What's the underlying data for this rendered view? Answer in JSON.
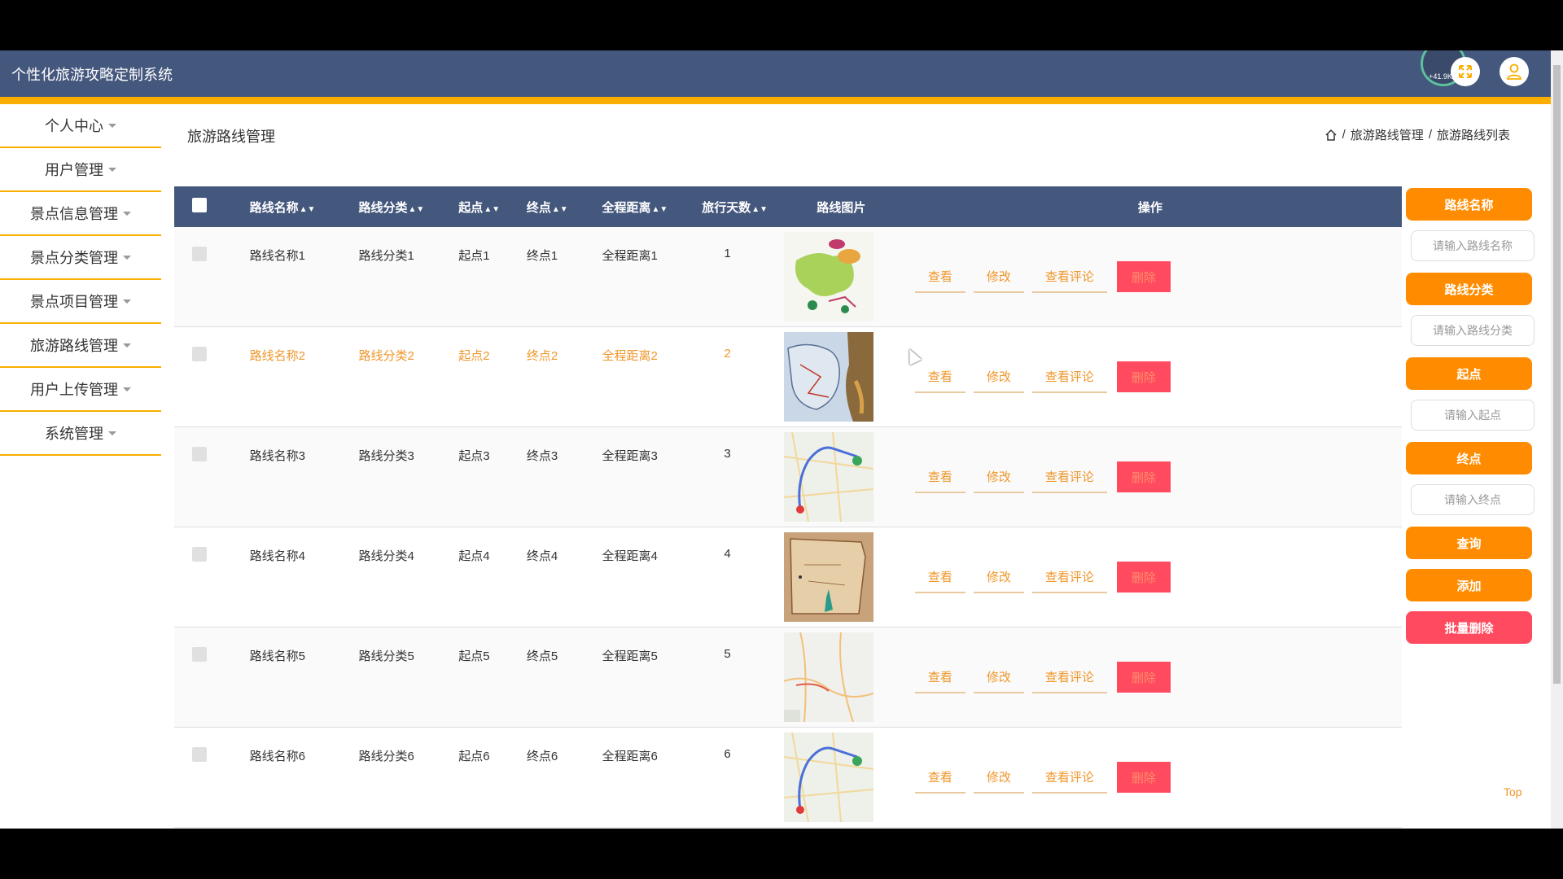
{
  "app": {
    "title": "个性化旅游攻略定制系统",
    "speed": "+41.9K/s"
  },
  "colors": {
    "header": "#44577d",
    "accent": "#f9ae00",
    "orange": "#ff8c00",
    "danger": "#ff4a5f",
    "link": "#f0962a"
  },
  "sidebar": {
    "items": [
      {
        "label": "个人中心"
      },
      {
        "label": "用户管理"
      },
      {
        "label": "景点信息管理"
      },
      {
        "label": "景点分类管理"
      },
      {
        "label": "景点项目管理"
      },
      {
        "label": "旅游路线管理"
      },
      {
        "label": "用户上传管理"
      },
      {
        "label": "系统管理"
      }
    ]
  },
  "page": {
    "title": "旅游路线管理"
  },
  "breadcrumb": {
    "level1": "旅游路线管理",
    "sep": "/",
    "level2": "旅游路线列表"
  },
  "table": {
    "headers": {
      "name": "路线名称",
      "category": "路线分类",
      "start": "起点",
      "end": "终点",
      "distance": "全程距离",
      "days": "旅行天数",
      "image": "路线图片",
      "ops": "操作"
    },
    "actions": {
      "view": "查看",
      "edit": "修改",
      "comments": "查看评论",
      "delete": "删除"
    },
    "rows": [
      {
        "name": "路线名称1",
        "category": "路线分类1",
        "start": "起点1",
        "end": "终点1",
        "distance": "全程距离1",
        "days": "1",
        "image": "map-green-thumbnail"
      },
      {
        "name": "路线名称2",
        "category": "路线分类2",
        "start": "起点2",
        "end": "终点2",
        "distance": "全程距离2",
        "days": "2",
        "image": "map-blue-thumbnail"
      },
      {
        "name": "路线名称3",
        "category": "路线分类3",
        "start": "起点3",
        "end": "终点3",
        "distance": "全程距离3",
        "days": "3",
        "image": "route-map-thumbnail"
      },
      {
        "name": "路线名称4",
        "category": "路线分类4",
        "start": "起点4",
        "end": "终点4",
        "distance": "全程距离4",
        "days": "4",
        "image": "map-brown-thumbnail"
      },
      {
        "name": "路线名称5",
        "category": "路线分类5",
        "start": "起点5",
        "end": "终点5",
        "distance": "全程距离5",
        "days": "5",
        "image": "road-map-thumbnail"
      },
      {
        "name": "路线名称6",
        "category": "路线分类6",
        "start": "起点6",
        "end": "终点6",
        "distance": "全程距离6",
        "days": "6",
        "image": "route-map-thumbnail"
      }
    ]
  },
  "search_panel": {
    "name_label": "路线名称",
    "name_placeholder": "请输入路线名称",
    "category_label": "路线分类",
    "category_placeholder": "请输入路线分类",
    "start_label": "起点",
    "start_placeholder": "请输入起点",
    "end_label": "终点",
    "end_placeholder": "请输入终点",
    "query": "查询",
    "add": "添加",
    "batch_delete": "批量删除"
  },
  "footer": {
    "top": "Top"
  }
}
